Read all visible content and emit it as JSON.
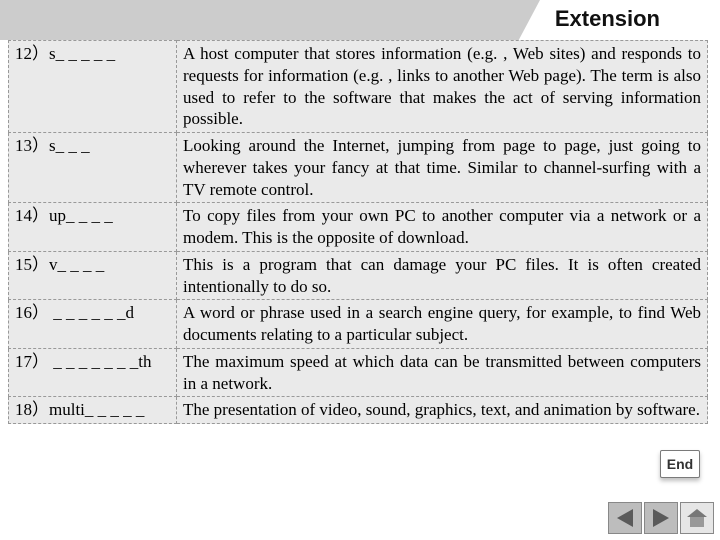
{
  "title": "Extension",
  "end_label": "End",
  "items": [
    {
      "term": "12）s_ _ _ _ _",
      "def": "A host computer that stores information (e.g. , Web sites) and responds to requests for information (e.g. , links to another Web page). The term is also used to refer to the software that makes the act of serving information possible."
    },
    {
      "term": "13）s_ _ _",
      "def": "Looking around the Internet, jumping from page to page, just going to wherever takes your fancy at that time. Similar to channel-surfing with a TV remote control."
    },
    {
      "term": "14）up_ _ _ _",
      "def": "To copy files from your own PC to another computer via a network or a modem. This is the opposite of download."
    },
    {
      "term": "15）v_ _ _ _",
      "def": "This is a program that can damage your PC files. It is often created intentionally to do so."
    },
    {
      "term": "16） _ _ _ _ _ _d",
      "def": "A word or phrase used in a search engine query, for example, to find Web documents relating to a particular subject."
    },
    {
      "term": "17） _ _ _ _ _ _ _th",
      "def": "The maximum speed at which data can be transmitted between computers in a network."
    },
    {
      "term": "18）multi_ _ _ _ _",
      "def": "The presentation of video, sound, graphics, text, and animation by software."
    }
  ]
}
